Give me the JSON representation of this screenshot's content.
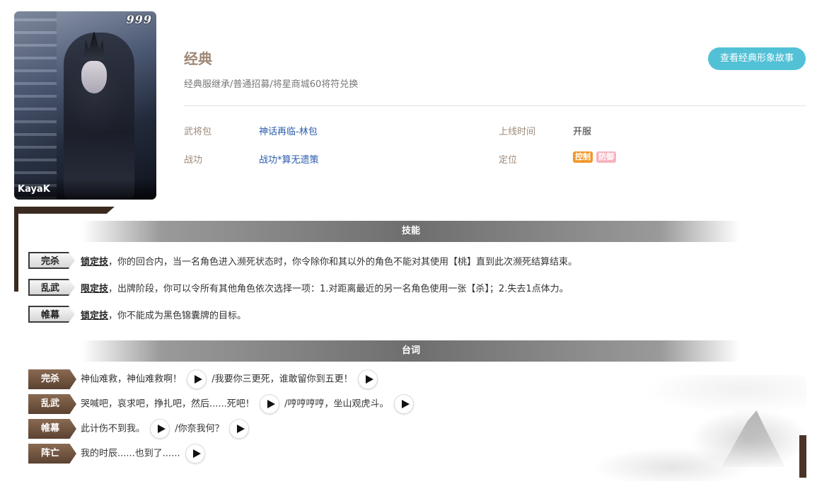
{
  "portrait": {
    "rank": "999",
    "artist": "KayaK"
  },
  "skin": {
    "title": "经典",
    "subtitle": "经典服继承/普通招募/将星商城60将符兑换",
    "story_button": "查看经典形象故事"
  },
  "info": {
    "pack_label": "武将包",
    "pack_value": "神话再临-林包",
    "merit_label": "战功",
    "merit_value": "战功*算无遗策",
    "release_label": "上线时间",
    "release_value": "开服",
    "role_label": "定位",
    "role_tags": [
      {
        "label": "控制",
        "color": "#f0972a"
      },
      {
        "label": "防御",
        "color": "#f6b2c0"
      }
    ]
  },
  "skills": {
    "header": "技能",
    "items": [
      {
        "name": "完杀",
        "type": "锁定技",
        "desc": "，你的回合内，当一名角色进入濒死状态时，你令除你和其以外的角色不能对其使用【桃】直到此次濒死结算结束。"
      },
      {
        "name": "乱武",
        "type": "限定技",
        "desc": "，出牌阶段，你可以令所有其他角色依次选择一项：1.对距离最近的另一名角色使用一张【杀】；2.失去1点体力。"
      },
      {
        "name": "帷幕",
        "type": "锁定技",
        "desc": "，你不能成为黑色锦囊牌的目标。"
      }
    ]
  },
  "quotes": {
    "header": "台词",
    "items": [
      {
        "name": "完杀",
        "line1": "神仙难救，神仙难救啊！",
        "line2": "/我要你三更死，谁敢留你到五更！"
      },
      {
        "name": "乱武",
        "line1": "哭喊吧，哀求吧，挣扎吧，然后......死吧！",
        "line2": "/哼哼哼哼，坐山观虎斗。"
      },
      {
        "name": "帷幕",
        "line1": "此计伤不到我。",
        "line2": "/你奈我何？"
      },
      {
        "name": "阵亡",
        "line1": "我的时辰......也到了......",
        "line2": ""
      }
    ]
  }
}
